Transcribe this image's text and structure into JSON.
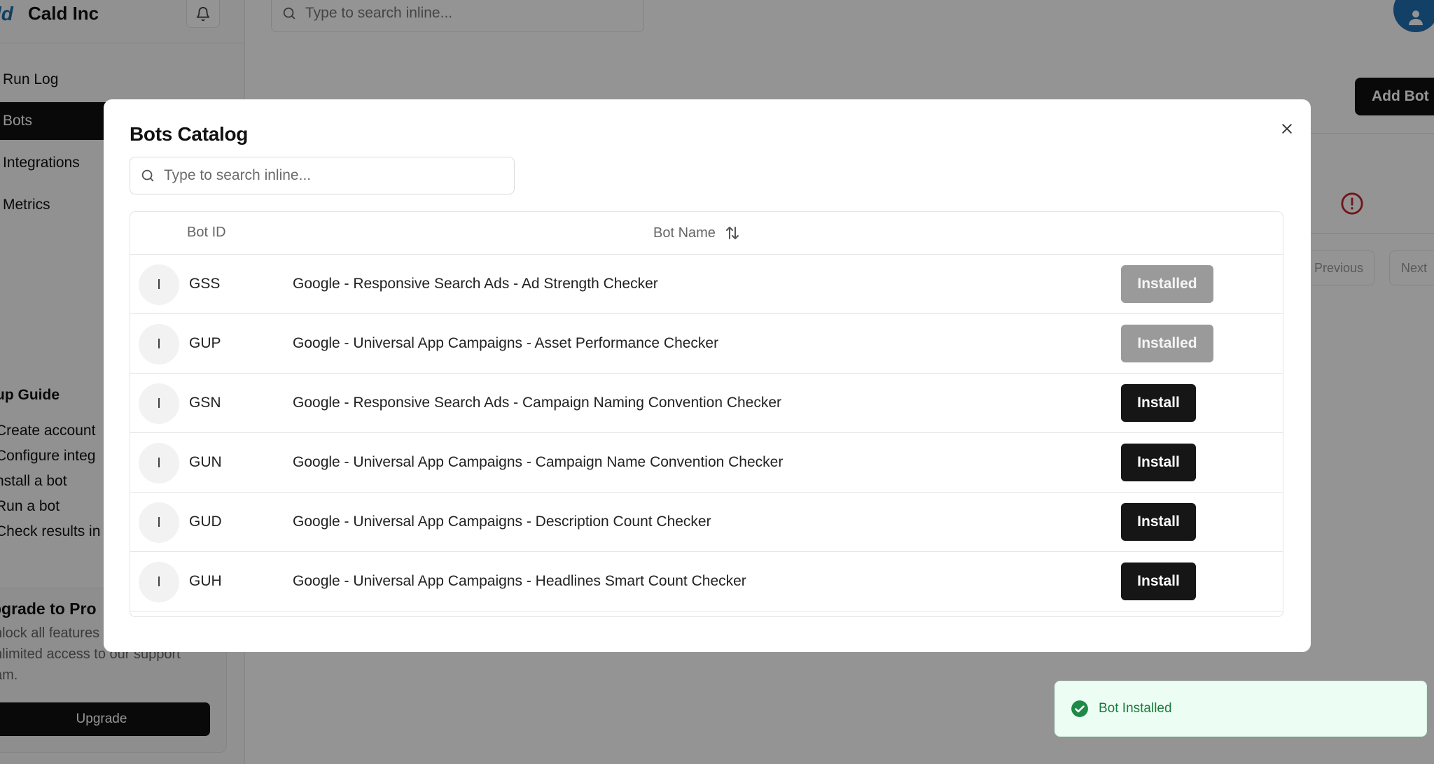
{
  "app": {
    "brand": "Cald Inc",
    "logo": "cald-logo-icon",
    "search_placeholder": "Type to search inline..."
  },
  "sidebar": {
    "items": [
      {
        "label": "Run Log",
        "active": false
      },
      {
        "label": "Bots",
        "active": true
      },
      {
        "label": "Integrations",
        "active": false
      },
      {
        "label": "Metrics",
        "active": false
      }
    ],
    "guide_title": "up Guide",
    "guide_steps": [
      "Create account",
      "Configure integ",
      "nstall a bot",
      "Run a bot",
      "Check results in"
    ],
    "upgrade": {
      "title": "pgrade to Pro",
      "description": "nlock all features\nnlimited access to our support\nam.",
      "button": "Upgrade"
    }
  },
  "main": {
    "add_bot_label": "Add Bot",
    "pagination": {
      "previous": "Previous",
      "next": "Next"
    }
  },
  "modal": {
    "title": "Bots Catalog",
    "search_placeholder": "Type to search inline...",
    "columns": {
      "bot_id": "Bot ID",
      "bot_name": "Bot Name"
    },
    "rows": [
      {
        "avatar": "I",
        "id": "GSS",
        "name": "Google - Responsive Search Ads - Ad Strength Checker",
        "action": "Installed"
      },
      {
        "avatar": "I",
        "id": "GUP",
        "name": "Google - Universal App Campaigns - Asset Performance Checker",
        "action": "Installed"
      },
      {
        "avatar": "I",
        "id": "GSN",
        "name": "Google - Responsive Search Ads - Campaign Naming Convention Checker",
        "action": "Install"
      },
      {
        "avatar": "I",
        "id": "GUN",
        "name": "Google - Universal App Campaigns - Campaign Name Convention Checker",
        "action": "Install"
      },
      {
        "avatar": "I",
        "id": "GUD",
        "name": "Google - Universal App Campaigns - Description Count Checker",
        "action": "Install"
      },
      {
        "avatar": "I",
        "id": "GUH",
        "name": "Google - Universal App Campaigns - Headlines Smart Count Checker",
        "action": "Install"
      }
    ]
  },
  "toast": {
    "message": "Bot Installed",
    "icon": "check-circle-icon",
    "color": "#1c7a3e"
  },
  "colors": {
    "accent": "#111111",
    "installed_button": "#9a9a9a",
    "avatar_blue": "#1f6fb0",
    "alert_red": "#c0262d"
  }
}
